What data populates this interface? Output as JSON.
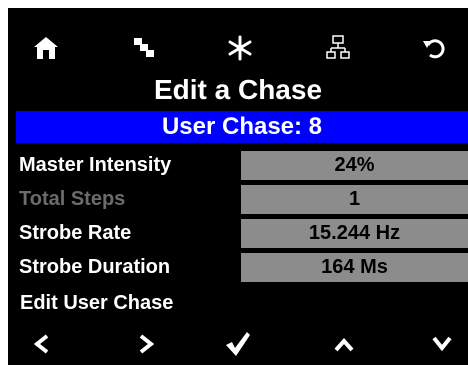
{
  "toolbar": {
    "icons": [
      "home-icon",
      "copy-layers-icon",
      "asterisk-icon",
      "network-icon",
      "undo-icon"
    ]
  },
  "header": {
    "title": "Edit a Chase"
  },
  "banner": {
    "text": "User Chase: 8",
    "color": "#0000ff"
  },
  "fields": [
    {
      "label": "Master Intensity",
      "value": "24%",
      "enabled": true
    },
    {
      "label": "Total Steps",
      "value": "1",
      "enabled": false
    },
    {
      "label": "Strobe Rate",
      "value": "15.244 Hz",
      "enabled": true
    },
    {
      "label": "Strobe Duration",
      "value": "164 Ms",
      "enabled": true
    }
  ],
  "edit_label": "Edit User Chase",
  "nav": {
    "icons": [
      "chevron-left-icon",
      "chevron-right-icon",
      "checkmark-icon",
      "chevron-up-icon",
      "chevron-down-icon"
    ]
  },
  "colors": {
    "background": "#000000",
    "value_box": "#8c8c8c",
    "disabled_text": "#6b6b6b"
  }
}
